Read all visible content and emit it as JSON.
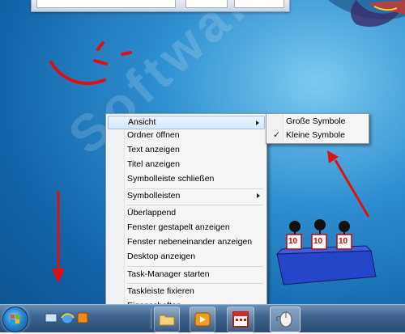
{
  "context_menu": {
    "items": [
      {
        "label": "Ansicht",
        "submenu": true,
        "highlighted": true
      },
      {
        "label": "Ordner öffnen"
      },
      {
        "label": "Text anzeigen"
      },
      {
        "label": "Titel anzeigen"
      },
      {
        "label": "Symbolleiste schließen"
      },
      {
        "label": "Symbolleisten",
        "submenu": true
      },
      {
        "label": "Überlappend"
      },
      {
        "label": "Fenster gestapelt anzeigen"
      },
      {
        "label": "Fenster nebeneinander anzeigen"
      },
      {
        "label": "Desktop anzeigen"
      },
      {
        "label": "Task-Manager starten"
      },
      {
        "label": "Taskleiste fixieren"
      },
      {
        "label": "Eigenschaften"
      }
    ]
  },
  "submenu": {
    "items": [
      {
        "label": "Große Symbole",
        "checked": false
      },
      {
        "label": "Kleine Symbole",
        "checked": true
      }
    ]
  },
  "watermark": {
    "text": "SoftwareOK.de"
  },
  "team": {
    "card_number": "10"
  },
  "colors": {
    "annotation_red": "#e01010",
    "smiley_red": "#e01010",
    "highlight_border": "#9ec2e8",
    "team_box": "#2545c8"
  },
  "icons": {
    "start": "windows-orb-icon",
    "quick_launch": [
      "show-desktop-icon",
      "internet-explorer-icon",
      "media-icon"
    ],
    "taskbar": [
      "folder-icon",
      "media-player-icon",
      "calendar-icon",
      "mouse-icon"
    ]
  }
}
